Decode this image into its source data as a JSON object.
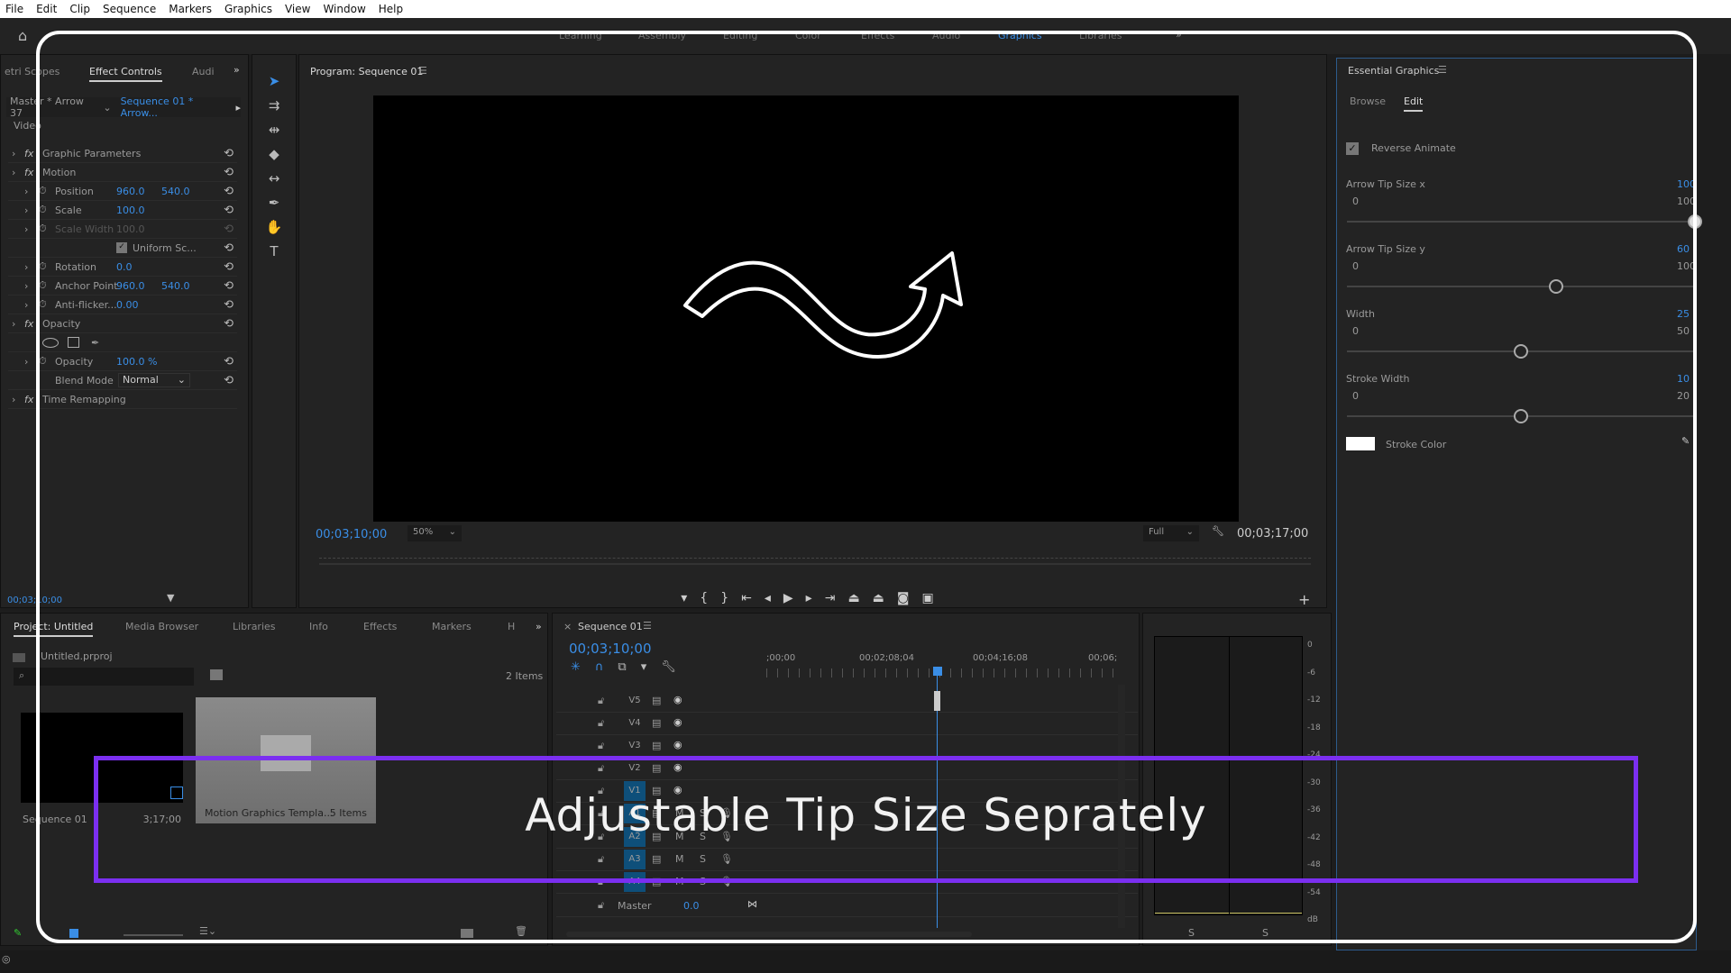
{
  "menu": [
    "File",
    "Edit",
    "Clip",
    "Sequence",
    "Markers",
    "Graphics",
    "View",
    "Window",
    "Help"
  ],
  "workspaces": [
    "Learning",
    "Assembly",
    "Editing",
    "Color",
    "Effects",
    "Audio",
    "Graphics",
    "Libraries"
  ],
  "active_workspace": "Graphics",
  "effect_controls": {
    "tabs": [
      "etri Scopes",
      "Effect Controls",
      "Audi"
    ],
    "master": "Master * Arrow 37",
    "sequence": "Sequence 01 * Arrow...",
    "video_label": "Video",
    "rows": [
      {
        "label": "Graphic Parameters",
        "fx": true
      },
      {
        "label": "Motion",
        "fx": true
      },
      {
        "label": "Position",
        "v1": "960.0",
        "v2": "540.0"
      },
      {
        "label": "Scale",
        "v1": "100.0"
      },
      {
        "label": "Scale Width",
        "v1": "100.0",
        "disabled": true
      },
      {
        "label": "Uniform Sc...",
        "checkbox": true
      },
      {
        "label": "Rotation",
        "v1": "0.0"
      },
      {
        "label": "Anchor Point",
        "v1": "960.0",
        "v2": "540.0"
      },
      {
        "label": "Anti-flicker...",
        "v1": "0.00"
      },
      {
        "label": "Opacity",
        "fx": true
      },
      {
        "label": ""
      },
      {
        "label": "Opacity",
        "v1": "100.0 %"
      },
      {
        "label": "Blend Mode",
        "select": "Normal"
      },
      {
        "label": "Time Remapping",
        "fx": true
      }
    ],
    "timecode": "00;03;10;00"
  },
  "program": {
    "title": "Program: Sequence 01",
    "timecode": "00;03;10;00",
    "zoom": "50%",
    "quality": "Full",
    "duration": "00;03;17;00",
    "playhead_fraction": 0.97
  },
  "essential_graphics": {
    "title": "Essential Graphics",
    "tabs": [
      "Browse",
      "Edit"
    ],
    "active_tab": "Edit",
    "reverse_animate": {
      "label": "Reverse Animate",
      "checked": true
    },
    "sliders": [
      {
        "label": "Arrow Tip Size x",
        "min": "0",
        "max": "100",
        "value": 100
      },
      {
        "label": "Arrow Tip Size y",
        "min": "0",
        "max": "100",
        "value": 60
      },
      {
        "label": "Width",
        "min": "0",
        "max": "50",
        "value": 25
      },
      {
        "label": "Stroke Width",
        "min": "0",
        "max": "20",
        "value": 10
      }
    ],
    "stroke_color": {
      "label": "Stroke Color",
      "value": "#ffffff"
    }
  },
  "project": {
    "tabs": [
      "Project: Untitled",
      "Media Browser",
      "Libraries",
      "Info",
      "Effects",
      "Markers",
      "H"
    ],
    "file": "Untitled.prproj",
    "count": "2 Items",
    "items": [
      {
        "name": "Sequence 01",
        "meta": "3;17;00"
      },
      {
        "name": "Motion Graphics Templa...",
        "meta": "5 Items"
      }
    ]
  },
  "timeline": {
    "title": "Sequence 01",
    "timecode": "00;03;10;00",
    "ruler": [
      ";00;00",
      "00;02;08;04",
      "00;04;16;08",
      "00;06;"
    ],
    "video_tracks": [
      "V5",
      "V4",
      "V3",
      "V2",
      "V1"
    ],
    "audio_tracks": [
      "A1",
      "A2",
      "A3",
      "A4"
    ],
    "master": {
      "label": "Master",
      "value": "0.0"
    },
    "mute": "M",
    "solo": "S"
  },
  "meters": {
    "scale": [
      "0",
      "-6",
      "-12",
      "-18",
      "-24",
      "-30",
      "-36",
      "-42",
      "-48",
      "-54",
      "dB"
    ],
    "solo": [
      "S",
      "S"
    ]
  },
  "caption": "Adjustable Tip Size Seprately",
  "colors": {
    "accent": "#3a8ee6",
    "highlight": "#7b2ff0",
    "overlay": "#ffffff"
  }
}
